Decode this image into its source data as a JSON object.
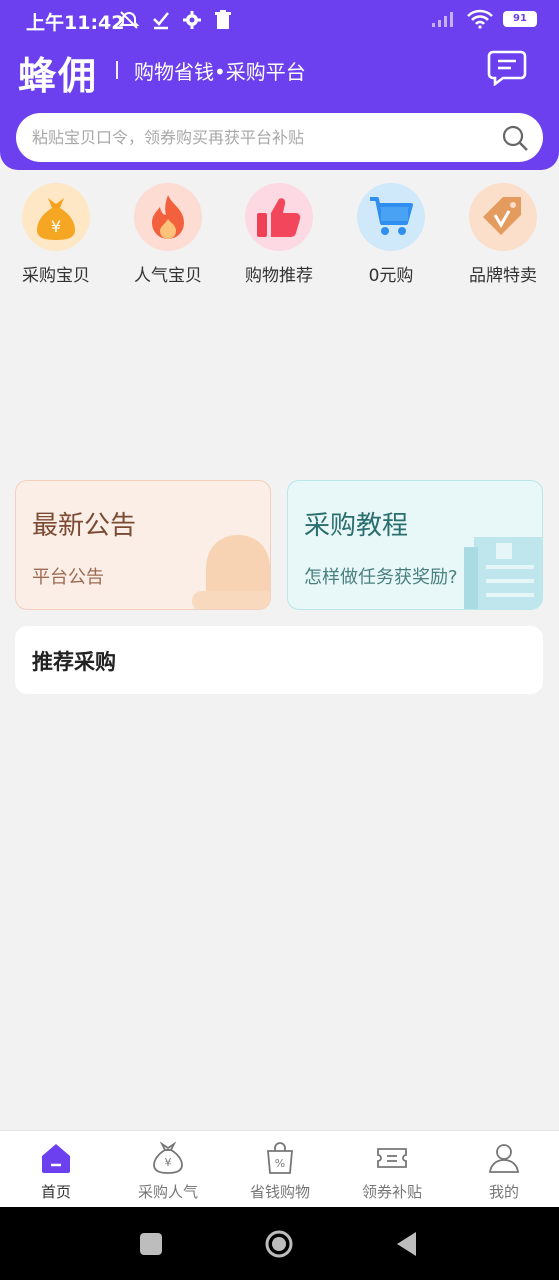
{
  "status": {
    "time": "上午11:42",
    "battery": "91"
  },
  "header": {
    "brand": "蜂佣",
    "subtitle": "购物省钱•采购平台"
  },
  "search": {
    "placeholder": "粘贴宝贝口令，领券购买再获平台补贴"
  },
  "categories": [
    {
      "label": "采购宝贝",
      "icon": "money-bag-icon",
      "color": "#fbe2b8"
    },
    {
      "label": "人气宝贝",
      "icon": "fire-icon",
      "color": "#fbd6cc"
    },
    {
      "label": "购物推荐",
      "icon": "thumbs-up-icon",
      "color": "#fbd3df"
    },
    {
      "label": "0元购",
      "icon": "cart-icon",
      "color": "#c9e7fb"
    },
    {
      "label": "品牌特卖",
      "icon": "tag-icon",
      "color": "#f9dcc5"
    }
  ],
  "cards": {
    "notice": {
      "title": "最新公告",
      "subtitle": "平台公告"
    },
    "tutorial": {
      "title": "采购教程",
      "subtitle": "怎样做任务获奖励?"
    }
  },
  "recommend": {
    "title": "推荐采购"
  },
  "nav": [
    {
      "label": "首页",
      "icon": "home-icon",
      "active": true
    },
    {
      "label": "采购人气",
      "icon": "money-bag-outline-icon"
    },
    {
      "label": "省钱购物",
      "icon": "shopping-bag-percent-icon"
    },
    {
      "label": "领券补贴",
      "icon": "coupon-icon"
    },
    {
      "label": "我的",
      "icon": "profile-icon"
    }
  ],
  "colors": {
    "accent": "#6c40ee"
  }
}
